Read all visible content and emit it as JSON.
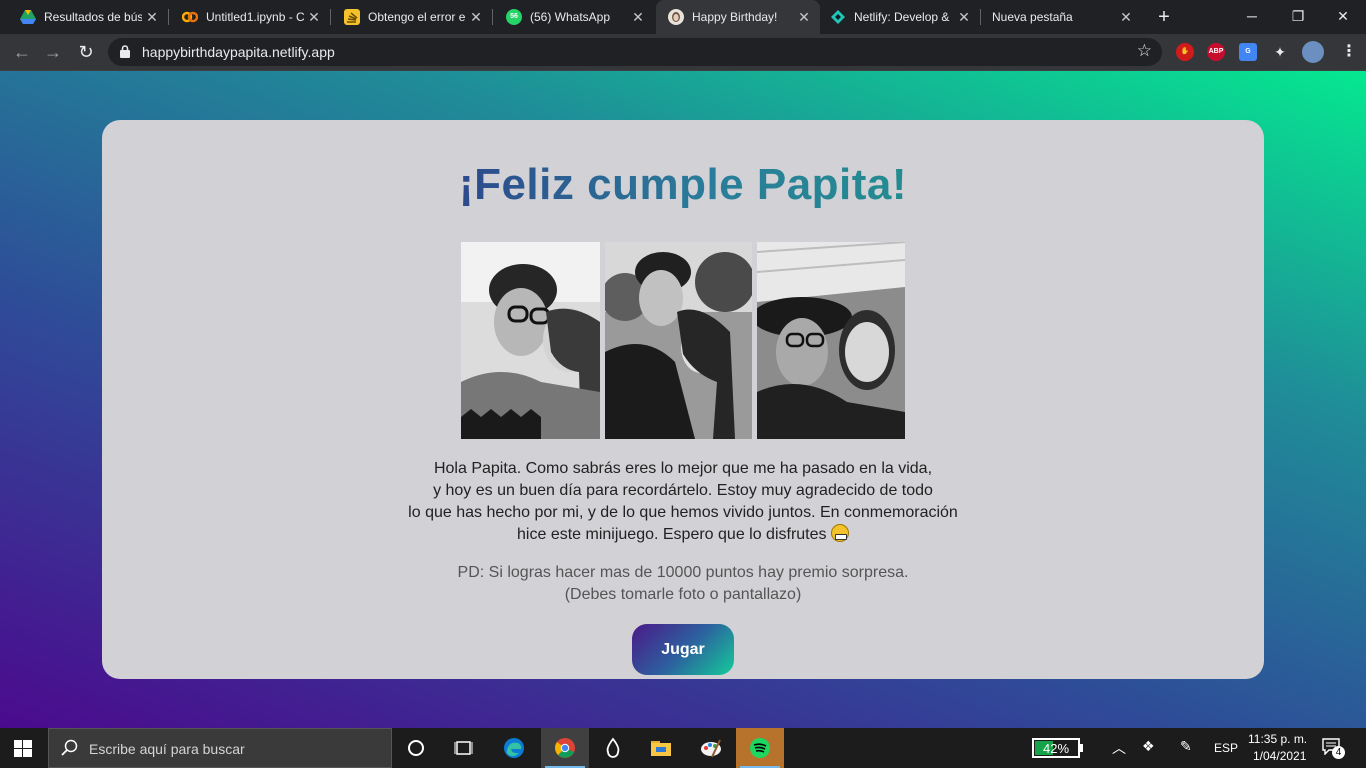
{
  "browser": {
    "tabs": [
      {
        "title": "Resultados de bús",
        "favicon": "google-drive-icon",
        "color": "#fbbc04"
      },
      {
        "title": "Untitled1.ipynb - C",
        "favicon": "colab-icon",
        "color": "#f9ab00"
      },
      {
        "title": "Obtengo el error e",
        "favicon": "stackoverflow-icon",
        "color": "#f48024"
      },
      {
        "title": "(56) WhatsApp",
        "favicon": "whatsapp-icon",
        "color": "#25d366"
      },
      {
        "title": "Happy Birthday!",
        "favicon": "portrait-icon",
        "color": "#c9b8a8",
        "active": true
      },
      {
        "title": "Netlify: Develop &",
        "favicon": "netlify-icon",
        "color": "#20c6b7"
      },
      {
        "title": "Nueva pestaña",
        "favicon": "",
        "color": ""
      }
    ],
    "whatsapp_badge": "56",
    "url": "happybirthdaypapita.netlify.app",
    "extensions": {
      "abp": "ABP"
    }
  },
  "page": {
    "title": "¡Feliz cumple Papita!",
    "message_lines": [
      "Hola Papita. Como sabrás eres lo mejor que me ha pasado en la vida,",
      "y hoy es un buen día para recordártelo. Estoy muy agradecido de todo",
      "lo que has hecho por mi, y de lo que hemos vivido juntos. En conmemoración",
      "hice este minijuego. Espero que lo disfrutes"
    ],
    "ps_lines": [
      "PD: Si logras hacer mas de 10000 puntos hay premio sorpresa.",
      "(Debes tomarle foto o pantallazo)"
    ],
    "play_button": "Jugar",
    "colors": {
      "title_start": "#2d4a8c",
      "title_end": "#238c90",
      "card": "#d2d1d6"
    }
  },
  "taskbar": {
    "search_placeholder": "Escribe aquí para buscar",
    "battery_percent": 42,
    "battery_label": "42%",
    "language": "ESP",
    "time": "11:35 p. m.",
    "date": "1/04/2021",
    "notifications": "4"
  }
}
